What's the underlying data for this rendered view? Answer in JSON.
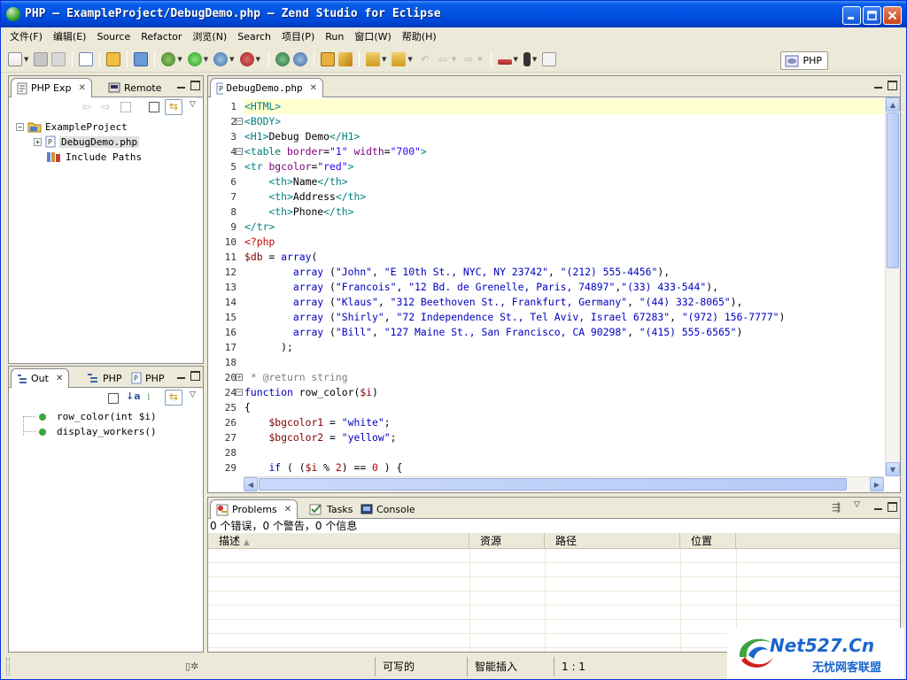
{
  "window": {
    "title": "PHP — ExampleProject/DebugDemo.php — Zend Studio for Eclipse"
  },
  "menubar": {
    "items": [
      "文件(F)",
      "编辑(E)",
      "Source",
      "Refactor",
      "浏览(N)",
      "Search",
      "项目(P)",
      "Run",
      "窗口(W)",
      "帮助(H)"
    ]
  },
  "perspective": {
    "label": "PHP"
  },
  "explorer": {
    "tabs": [
      {
        "label": "PHP Exp",
        "active": true
      },
      {
        "label": "Remote",
        "active": false
      }
    ],
    "tree": [
      {
        "label": "ExampleProject",
        "level": 0,
        "expanded": true
      },
      {
        "label": "DebugDemo.php",
        "level": 1,
        "selected": true
      },
      {
        "label": "Include Paths",
        "level": 1
      }
    ]
  },
  "outline": {
    "tabs": [
      {
        "label": "Out",
        "active": true
      },
      {
        "label": "PHP",
        "active": false
      },
      {
        "label": "PHP",
        "active": false
      }
    ],
    "items": [
      "row_color(int $i)",
      "display_workers()"
    ]
  },
  "editor": {
    "tab_label": "DebugDemo.php",
    "lines": [
      {
        "n": "1",
        "tokens": [
          [
            "t-tag",
            "<HTML>"
          ]
        ],
        "current": true
      },
      {
        "n": "2",
        "fold": "-",
        "tokens": [
          [
            "t-tag",
            "<BODY>"
          ]
        ]
      },
      {
        "n": "3",
        "tokens": [
          [
            "t-tag",
            "<H1>"
          ],
          [
            "t-txt",
            "Debug Demo"
          ],
          [
            "t-tag",
            "</H1>"
          ]
        ]
      },
      {
        "n": "4",
        "fold": "-",
        "tokens": [
          [
            "t-tag",
            "<table "
          ],
          [
            "t-attr",
            "border"
          ],
          [
            "t-txt",
            "="
          ],
          [
            "t-val",
            "\"1\""
          ],
          [
            "t-txt",
            " "
          ],
          [
            "t-attr",
            "width"
          ],
          [
            "t-txt",
            "="
          ],
          [
            "t-val",
            "\"700\""
          ],
          [
            "t-tag",
            ">"
          ]
        ]
      },
      {
        "n": "5",
        "tokens": [
          [
            "t-tag",
            "<tr "
          ],
          [
            "t-attr",
            "bgcolor"
          ],
          [
            "t-txt",
            "="
          ],
          [
            "t-val",
            "\"red\""
          ],
          [
            "t-tag",
            ">"
          ]
        ]
      },
      {
        "n": "6",
        "tokens": [
          [
            "t-txt",
            "    "
          ],
          [
            "t-tag",
            "<th>"
          ],
          [
            "t-txt",
            "Name"
          ],
          [
            "t-tag",
            "</th>"
          ]
        ]
      },
      {
        "n": "7",
        "tokens": [
          [
            "t-txt",
            "    "
          ],
          [
            "t-tag",
            "<th>"
          ],
          [
            "t-txt",
            "Address"
          ],
          [
            "t-tag",
            "</th>"
          ]
        ]
      },
      {
        "n": "8",
        "tokens": [
          [
            "t-txt",
            "    "
          ],
          [
            "t-tag",
            "<th>"
          ],
          [
            "t-txt",
            "Phone"
          ],
          [
            "t-tag",
            "</th>"
          ]
        ]
      },
      {
        "n": "9",
        "tokens": [
          [
            "t-tag",
            "</tr>"
          ]
        ]
      },
      {
        "n": "10",
        "tokens": [
          [
            "t-php",
            "<?php"
          ]
        ]
      },
      {
        "n": "11",
        "tokens": [
          [
            "t-var",
            "$db"
          ],
          [
            "t-txt",
            " = "
          ],
          [
            "t-kw",
            "array"
          ],
          [
            "t-txt",
            "("
          ]
        ]
      },
      {
        "n": "12",
        "tokens": [
          [
            "t-txt",
            "        "
          ],
          [
            "t-kw",
            "array"
          ],
          [
            "t-txt",
            " ("
          ],
          [
            "t-str",
            "\"John\""
          ],
          [
            "t-txt",
            ", "
          ],
          [
            "t-str",
            "\"E 10th St., NYC, NY 23742\""
          ],
          [
            "t-txt",
            ", "
          ],
          [
            "t-str",
            "\"(212) 555-4456\""
          ],
          [
            "t-txt",
            "),"
          ]
        ]
      },
      {
        "n": "13",
        "tokens": [
          [
            "t-txt",
            "        "
          ],
          [
            "t-kw",
            "array"
          ],
          [
            "t-txt",
            " ("
          ],
          [
            "t-str",
            "\"Francois\""
          ],
          [
            "t-txt",
            ", "
          ],
          [
            "t-str",
            "\"12 Bd. de Grenelle, Paris, 74897\""
          ],
          [
            "t-txt",
            ","
          ],
          [
            "t-str",
            "\"(33) 433-544\""
          ],
          [
            "t-txt",
            "),"
          ]
        ]
      },
      {
        "n": "14",
        "tokens": [
          [
            "t-txt",
            "        "
          ],
          [
            "t-kw",
            "array"
          ],
          [
            "t-txt",
            " ("
          ],
          [
            "t-str",
            "\"Klaus\""
          ],
          [
            "t-txt",
            ", "
          ],
          [
            "t-str",
            "\"312 Beethoven St., Frankfurt, Germany\""
          ],
          [
            "t-txt",
            ", "
          ],
          [
            "t-str",
            "\"(44) 332-8065\""
          ],
          [
            "t-txt",
            "),"
          ]
        ]
      },
      {
        "n": "15",
        "tokens": [
          [
            "t-txt",
            "        "
          ],
          [
            "t-kw",
            "array"
          ],
          [
            "t-txt",
            " ("
          ],
          [
            "t-str",
            "\"Shirly\""
          ],
          [
            "t-txt",
            ", "
          ],
          [
            "t-str",
            "\"72 Independence St., Tel Aviv, Israel 67283\""
          ],
          [
            "t-txt",
            ", "
          ],
          [
            "t-str",
            "\"(972) 156-7777\""
          ],
          [
            "t-txt",
            ")"
          ]
        ]
      },
      {
        "n": "16",
        "tokens": [
          [
            "t-txt",
            "        "
          ],
          [
            "t-kw",
            "array"
          ],
          [
            "t-txt",
            " ("
          ],
          [
            "t-str",
            "\"Bill\""
          ],
          [
            "t-txt",
            ", "
          ],
          [
            "t-str",
            "\"127 Maine St., San Francisco, CA 90298\""
          ],
          [
            "t-txt",
            ", "
          ],
          [
            "t-str",
            "\"(415) 555-6565\""
          ],
          [
            "t-txt",
            ")"
          ]
        ]
      },
      {
        "n": "17",
        "tokens": [
          [
            "t-txt",
            "      );"
          ]
        ]
      },
      {
        "n": "18",
        "tokens": []
      },
      {
        "n": "20",
        "fold": "+",
        "tokens": [
          [
            "t-cm",
            " * @return string"
          ]
        ]
      },
      {
        "n": "24",
        "fold": "-",
        "tokens": [
          [
            "t-kw",
            "function"
          ],
          [
            "t-txt",
            " row_color("
          ],
          [
            "t-var",
            "$i"
          ],
          [
            "t-txt",
            ")"
          ]
        ]
      },
      {
        "n": "25",
        "tokens": [
          [
            "t-txt",
            "{"
          ]
        ]
      },
      {
        "n": "26",
        "tokens": [
          [
            "t-txt",
            "    "
          ],
          [
            "t-var",
            "$bgcolor1"
          ],
          [
            "t-txt",
            " = "
          ],
          [
            "t-str",
            "\"white\""
          ],
          [
            "t-txt",
            ";"
          ]
        ]
      },
      {
        "n": "27",
        "tokens": [
          [
            "t-txt",
            "    "
          ],
          [
            "t-var",
            "$bgcolor2"
          ],
          [
            "t-txt",
            " = "
          ],
          [
            "t-str",
            "\"yellow\""
          ],
          [
            "t-txt",
            ";"
          ]
        ]
      },
      {
        "n": "28",
        "tokens": []
      },
      {
        "n": "29",
        "tokens": [
          [
            "t-txt",
            "    "
          ],
          [
            "t-kw",
            "if"
          ],
          [
            "t-txt",
            " ( ("
          ],
          [
            "t-var",
            "$i"
          ],
          [
            "t-txt",
            " % "
          ],
          [
            "t-num",
            "2"
          ],
          [
            "t-txt",
            ") == "
          ],
          [
            "t-num",
            "0"
          ],
          [
            "t-txt",
            " ) {"
          ]
        ]
      }
    ]
  },
  "problems": {
    "tabs": [
      {
        "label": "Problems",
        "active": true
      },
      {
        "label": "Tasks",
        "active": false
      },
      {
        "label": "Console",
        "active": false
      }
    ],
    "summary": "0 个错误，0 个警告，0 个信息",
    "columns": [
      "描述",
      "资源",
      "路径",
      "位置"
    ]
  },
  "statusbar": {
    "writable": "可写的",
    "insert_mode": "智能插入",
    "position": "1 : 1"
  },
  "watermark": {
    "site": "Net527.Cn",
    "slogan": "无忧网客联盟"
  }
}
